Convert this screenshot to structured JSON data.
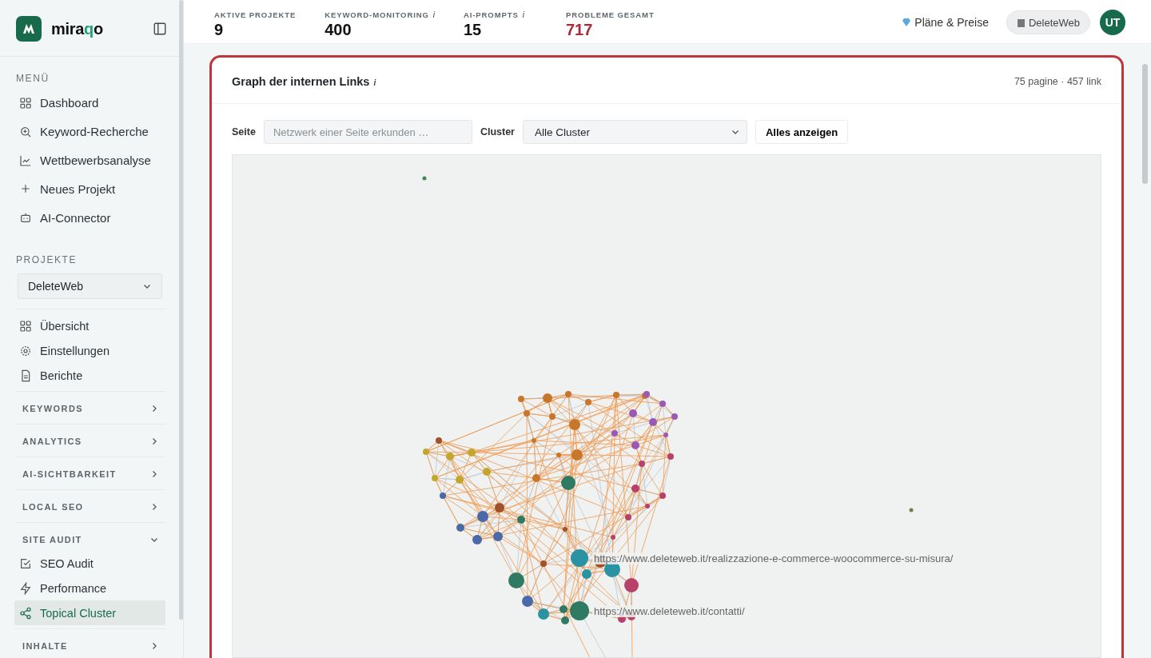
{
  "sidebar": {
    "logo": [
      {
        "text": "mira",
        "accent": false
      },
      {
        "text": "q",
        "accent": true
      },
      {
        "text": "o",
        "accent": false
      }
    ],
    "menu_heading": "MENÜ",
    "menu": [
      {
        "label": "Dashboard"
      },
      {
        "label": "Keyword-Recherche"
      },
      {
        "label": "Wettbewerbsanalyse"
      },
      {
        "label": "Neues Projekt"
      },
      {
        "label": "AI-Connector"
      }
    ],
    "projects_heading": "PROJEKTE",
    "project_select": "DeleteWeb",
    "project_items": [
      {
        "label": "Übersicht"
      },
      {
        "label": "Einstellungen"
      },
      {
        "label": "Berichte"
      }
    ],
    "sections": [
      {
        "label": "KEYWORDS",
        "expanded": false
      },
      {
        "label": "ANALYTICS",
        "expanded": false
      },
      {
        "label": "AI-SICHTBARKEIT",
        "expanded": false
      },
      {
        "label": "LOCAL SEO",
        "expanded": false
      },
      {
        "label": "SITE AUDIT",
        "expanded": true,
        "items": [
          {
            "label": "SEO Audit",
            "selected": false
          },
          {
            "label": "Performance",
            "selected": false
          },
          {
            "label": "Topical Cluster",
            "selected": true
          }
        ]
      },
      {
        "label": "INHALTE",
        "expanded": false
      }
    ]
  },
  "stats": [
    {
      "label": "AKTIVE PROJEKTE",
      "value": "9",
      "alert": false
    },
    {
      "label": "KEYWORD-MONITORING",
      "info": "i",
      "value": "400",
      "alert": false
    },
    {
      "label": "AI-PROMPTS",
      "info": "i",
      "value": "15",
      "alert": false
    },
    {
      "label": "PROBLEME GESAMT",
      "value": "717",
      "alert": true
    }
  ],
  "header": {
    "plans_link": "Pläne & Preise",
    "workspace": "DeleteWeb",
    "avatar": "UT"
  },
  "card": {
    "title": "Graph der internen Links",
    "info": "i",
    "summary": "75 pagine · 457 link",
    "page_label": "Seite",
    "page_placeholder": "Netzwerk einer Seite erkunden …",
    "cluster_label": "Cluster",
    "cluster_value": "Alle Cluster",
    "show_all_button": "Alles anzeigen",
    "graph_labels": [
      "https://www.deleteweb.it/realizzazione-e-commerce-woocommerce-su-misura/",
      "https://www.deleteweb.it/contatti/"
    ]
  }
}
